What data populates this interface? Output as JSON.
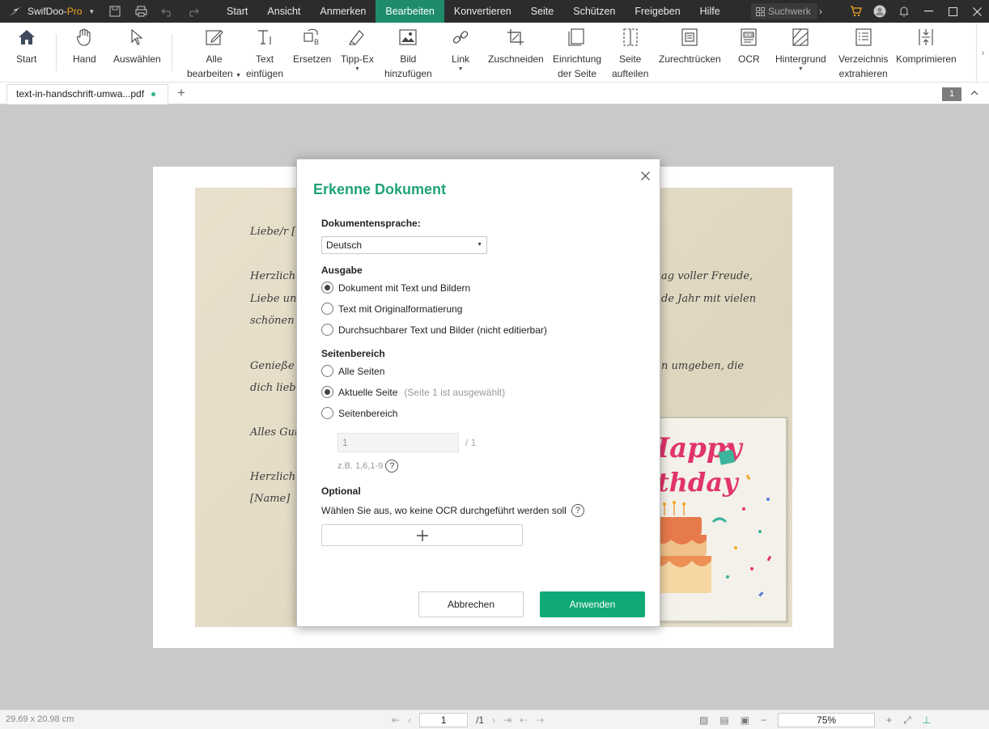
{
  "titlebar": {
    "app_name_prefix": "SwifDoo-",
    "app_name_suffix": "Pro",
    "menu": [
      "Start",
      "Ansicht",
      "Anmerken",
      "Bearbeiten",
      "Konvertieren",
      "Seite",
      "Schützen",
      "Freigeben",
      "Hilfe"
    ],
    "active_menu": "Bearbeiten",
    "search_placeholder": "Suchwerk"
  },
  "ribbon": {
    "tools": [
      {
        "id": "start",
        "label1": "Start",
        "label2": "",
        "icon": "home-icon"
      },
      {
        "id": "hand",
        "label1": "Hand",
        "label2": "",
        "icon": "hand-icon"
      },
      {
        "id": "select",
        "label1": "Auswählen",
        "label2": "",
        "icon": "cursor-icon"
      },
      {
        "id": "edit-all",
        "label1": "Alle",
        "label2": "bearbeiten",
        "icon": "edit-icon",
        "dropdown": true
      },
      {
        "id": "insert-text",
        "label1": "Text",
        "label2": "einfügen",
        "icon": "text-insert-icon"
      },
      {
        "id": "replace",
        "label1": "Ersetzen",
        "label2": "",
        "icon": "replace-icon"
      },
      {
        "id": "typex",
        "label1": "Tipp-Ex",
        "label2": "",
        "icon": "eraser-icon",
        "dropdown": true
      },
      {
        "id": "add-image",
        "label1": "Bild",
        "label2": "hinzufügen",
        "icon": "image-icon"
      },
      {
        "id": "link",
        "label1": "Link",
        "label2": "",
        "icon": "link-icon",
        "dropdown": true
      },
      {
        "id": "crop",
        "label1": "Zuschneiden",
        "label2": "",
        "icon": "crop-icon"
      },
      {
        "id": "page-setup",
        "label1": "Einrichtung",
        "label2": "der Seite",
        "icon": "page-setup-icon"
      },
      {
        "id": "split-page",
        "label1": "Seite",
        "label2": "aufteilen",
        "icon": "split-icon"
      },
      {
        "id": "straighten",
        "label1": "Zurechtrücken",
        "label2": "",
        "icon": "straighten-icon"
      },
      {
        "id": "ocr",
        "label1": "OCR",
        "label2": "",
        "icon": "ocr-icon"
      },
      {
        "id": "background",
        "label1": "Hintergrund",
        "label2": "",
        "icon": "background-icon",
        "dropdown": true
      },
      {
        "id": "extract-toc",
        "label1": "Verzeichnis",
        "label2": "extrahieren",
        "icon": "toc-icon"
      },
      {
        "id": "compress",
        "label1": "Komprimieren",
        "label2": "",
        "icon": "compress-icon"
      }
    ]
  },
  "tabs": {
    "doc_name": "text-in-handschrift-umwa...pdf",
    "page_count": "1"
  },
  "document": {
    "lines": [
      "Liebe/r [",
      "Herzliche",
      "Liebe un",
      "schönen",
      "Genieße d",
      "dich liebe",
      "Alles Gut",
      "Herzliche",
      "[Name]",
      "ag voller Freude,",
      "de Jahr mit vielen",
      "n umgeben, die"
    ],
    "card_text1": "Happy",
    "card_text2": "rthday"
  },
  "statusbar": {
    "page_size": "29.69 x 20.98 cm",
    "current_page": "1",
    "total_pages": "/1",
    "zoom": "75%"
  },
  "dialog": {
    "title": "Erkenne Dokument",
    "language_label": "Dokumentensprache:",
    "language_value": "Deutsch",
    "output_label": "Ausgabe",
    "output_options": [
      "Dokument mit Text und Bildern",
      "Text mit Originalformatierung",
      "Durchsuchbarer Text und Bilder (nicht editierbar)"
    ],
    "output_selected": 0,
    "range_label": "Seitenbereich",
    "range_options": [
      "Alle Seiten",
      "Aktuelle Seite",
      "Seitenbereich"
    ],
    "range_hint": "(Seite 1 ist ausgewählt)",
    "range_selected": 1,
    "range_input_value": "1",
    "range_total": "/ 1",
    "range_example": "z.B. 1,6,1-9",
    "optional_label": "Optional",
    "optional_desc": "Wählen Sie aus, wo keine OCR durchgeführt werden soll",
    "cancel_label": "Abbrechen",
    "apply_label": "Anwenden"
  },
  "colors": {
    "accent": "#1fa37a",
    "apply_button": "#10a978",
    "titlebar": "#2c2c2c",
    "active_menu": "#1e8c6b"
  }
}
